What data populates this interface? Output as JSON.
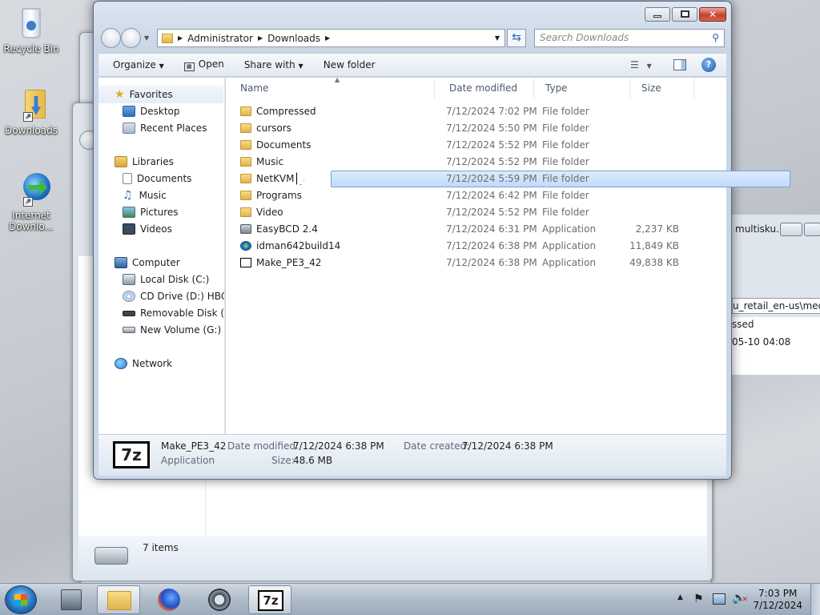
{
  "desktop": {
    "icons": [
      {
        "label": "Recycle Bin"
      },
      {
        "label": "Downloads"
      },
      {
        "label": "Internet Downlo..."
      }
    ]
  },
  "background_window": {
    "title_fragment": "multisku...",
    "path_fragment": "u_retail_en-us\\media",
    "col_fragment": "ssed",
    "date_fragment": "05-10 04:08",
    "status": "7 items"
  },
  "explorer": {
    "address": {
      "root": "Administrator",
      "folder": "Downloads"
    },
    "search_placeholder": "Search Downloads",
    "toolbar": {
      "organize": "Organize",
      "open": "Open",
      "share_with": "Share with",
      "new_folder": "New folder"
    },
    "nav": {
      "favorites": "Favorites",
      "desktop": "Desktop",
      "recent": "Recent Places",
      "libraries": "Libraries",
      "documents": "Documents",
      "music": "Music",
      "pictures": "Pictures",
      "videos": "Videos",
      "computer": "Computer",
      "local_disk": "Local Disk (C:)",
      "cd_drive": "CD Drive (D:) HBCD_",
      "removable": "Removable Disk (E:)",
      "new_volume": "New Volume (G:)",
      "network": "Network"
    },
    "columns": {
      "name": "Name",
      "date": "Date modified",
      "type": "Type",
      "size": "Size"
    },
    "files": [
      {
        "name": "Compressed",
        "date": "7/12/2024 7:02 PM",
        "type": "File folder",
        "size": ""
      },
      {
        "name": "cursors",
        "date": "7/12/2024 5:50 PM",
        "type": "File folder",
        "size": ""
      },
      {
        "name": "Documents",
        "date": "7/12/2024 5:52 PM",
        "type": "File folder",
        "size": ""
      },
      {
        "name": "Music",
        "date": "7/12/2024 5:52 PM",
        "type": "File folder",
        "size": ""
      },
      {
        "name": "NetKVM",
        "date": "7/12/2024 5:59 PM",
        "type": "File folder",
        "size": ""
      },
      {
        "name": "Programs",
        "date": "7/12/2024 6:42 PM",
        "type": "File folder",
        "size": ""
      },
      {
        "name": "Video",
        "date": "7/12/2024 5:52 PM",
        "type": "File folder",
        "size": ""
      },
      {
        "name": "EasyBCD 2.4",
        "date": "7/12/2024 6:31 PM",
        "type": "Application",
        "size": "2,237 KB"
      },
      {
        "name": "idman642build14",
        "date": "7/12/2024 6:38 PM",
        "type": "Application",
        "size": "11,849 KB"
      },
      {
        "name": "Make_PE3_42",
        "date": "7/12/2024 6:38 PM",
        "type": "Application",
        "size": "49,838 KB"
      }
    ],
    "details": {
      "icon_text": "7z",
      "name": "Make_PE3_42",
      "kind": "Application",
      "date_modified_label": "Date modified:",
      "date_modified": "7/12/2024 6:38 PM",
      "date_created_label": "Date created:",
      "date_created": "7/12/2024 6:38 PM",
      "size_label": "Size:",
      "size": "48.6 MB"
    }
  },
  "taskbar": {
    "seven_zip_text": "7z",
    "time": "7:03 PM",
    "date": "7/12/2024"
  }
}
